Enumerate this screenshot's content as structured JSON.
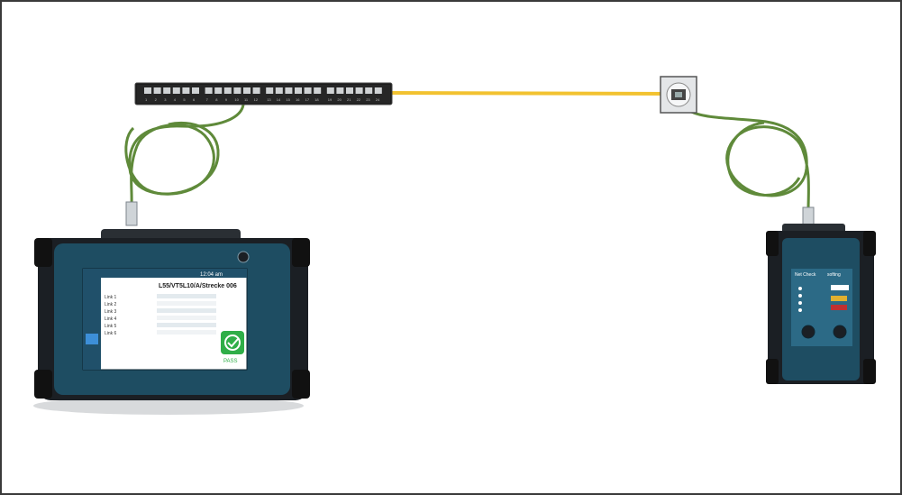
{
  "diagram": {
    "colors": {
      "patch_cable": "#f2c230",
      "cord": "#5f8a3a",
      "device_body": "#1e4d62",
      "device_dark": "#1b1f24",
      "screen_bg": "#ffffff",
      "sidebar": "#20506a",
      "pass_green": "#2fae48"
    },
    "patch_panel": {
      "port_labels": [
        "1",
        "2",
        "3",
        "4",
        "5",
        "6",
        "7",
        "8",
        "9",
        "10",
        "11",
        "12",
        "13",
        "14",
        "15",
        "16",
        "17",
        "18",
        "19",
        "20",
        "21",
        "22",
        "23",
        "24"
      ]
    },
    "main_unit": {
      "screen_title": "L55/VT5L10/A/Strecke 006",
      "status_text": "12:04 am",
      "result_label": "PASS",
      "rows": [
        "Link 1",
        "Link 2",
        "Link 3",
        "Link 4",
        "Link 5",
        "Link 6"
      ]
    },
    "remote_unit": {
      "brand": "Net Check",
      "badge": "softing"
    }
  }
}
